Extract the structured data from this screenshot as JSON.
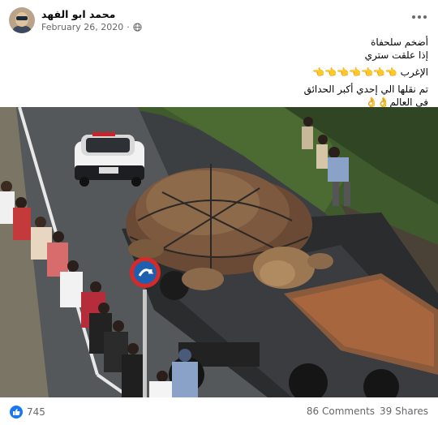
{
  "post": {
    "author": "محمد ابو الفهد",
    "date": "February 26, 2020",
    "privacy_icon": "globe-icon",
    "menu_icon": "more-horizontal-icon",
    "text_lines": [
      "أضخم سلحفاة",
      "إذا علقت ستري",
      "الإغرب 👈👈👈👈👈👈👈",
      "تم نقلها الي إحدي أكبر الحدائق",
      "في العالم👌👌"
    ]
  },
  "photo": {
    "icon": "photo-image"
  },
  "footer": {
    "reaction_icon": "like-icon",
    "reaction_count": "745",
    "comments": "86 Comments",
    "shares": "39 Shares"
  },
  "colors": {
    "accent": "#1877f2",
    "meta": "#65676b",
    "text": "#050505"
  }
}
